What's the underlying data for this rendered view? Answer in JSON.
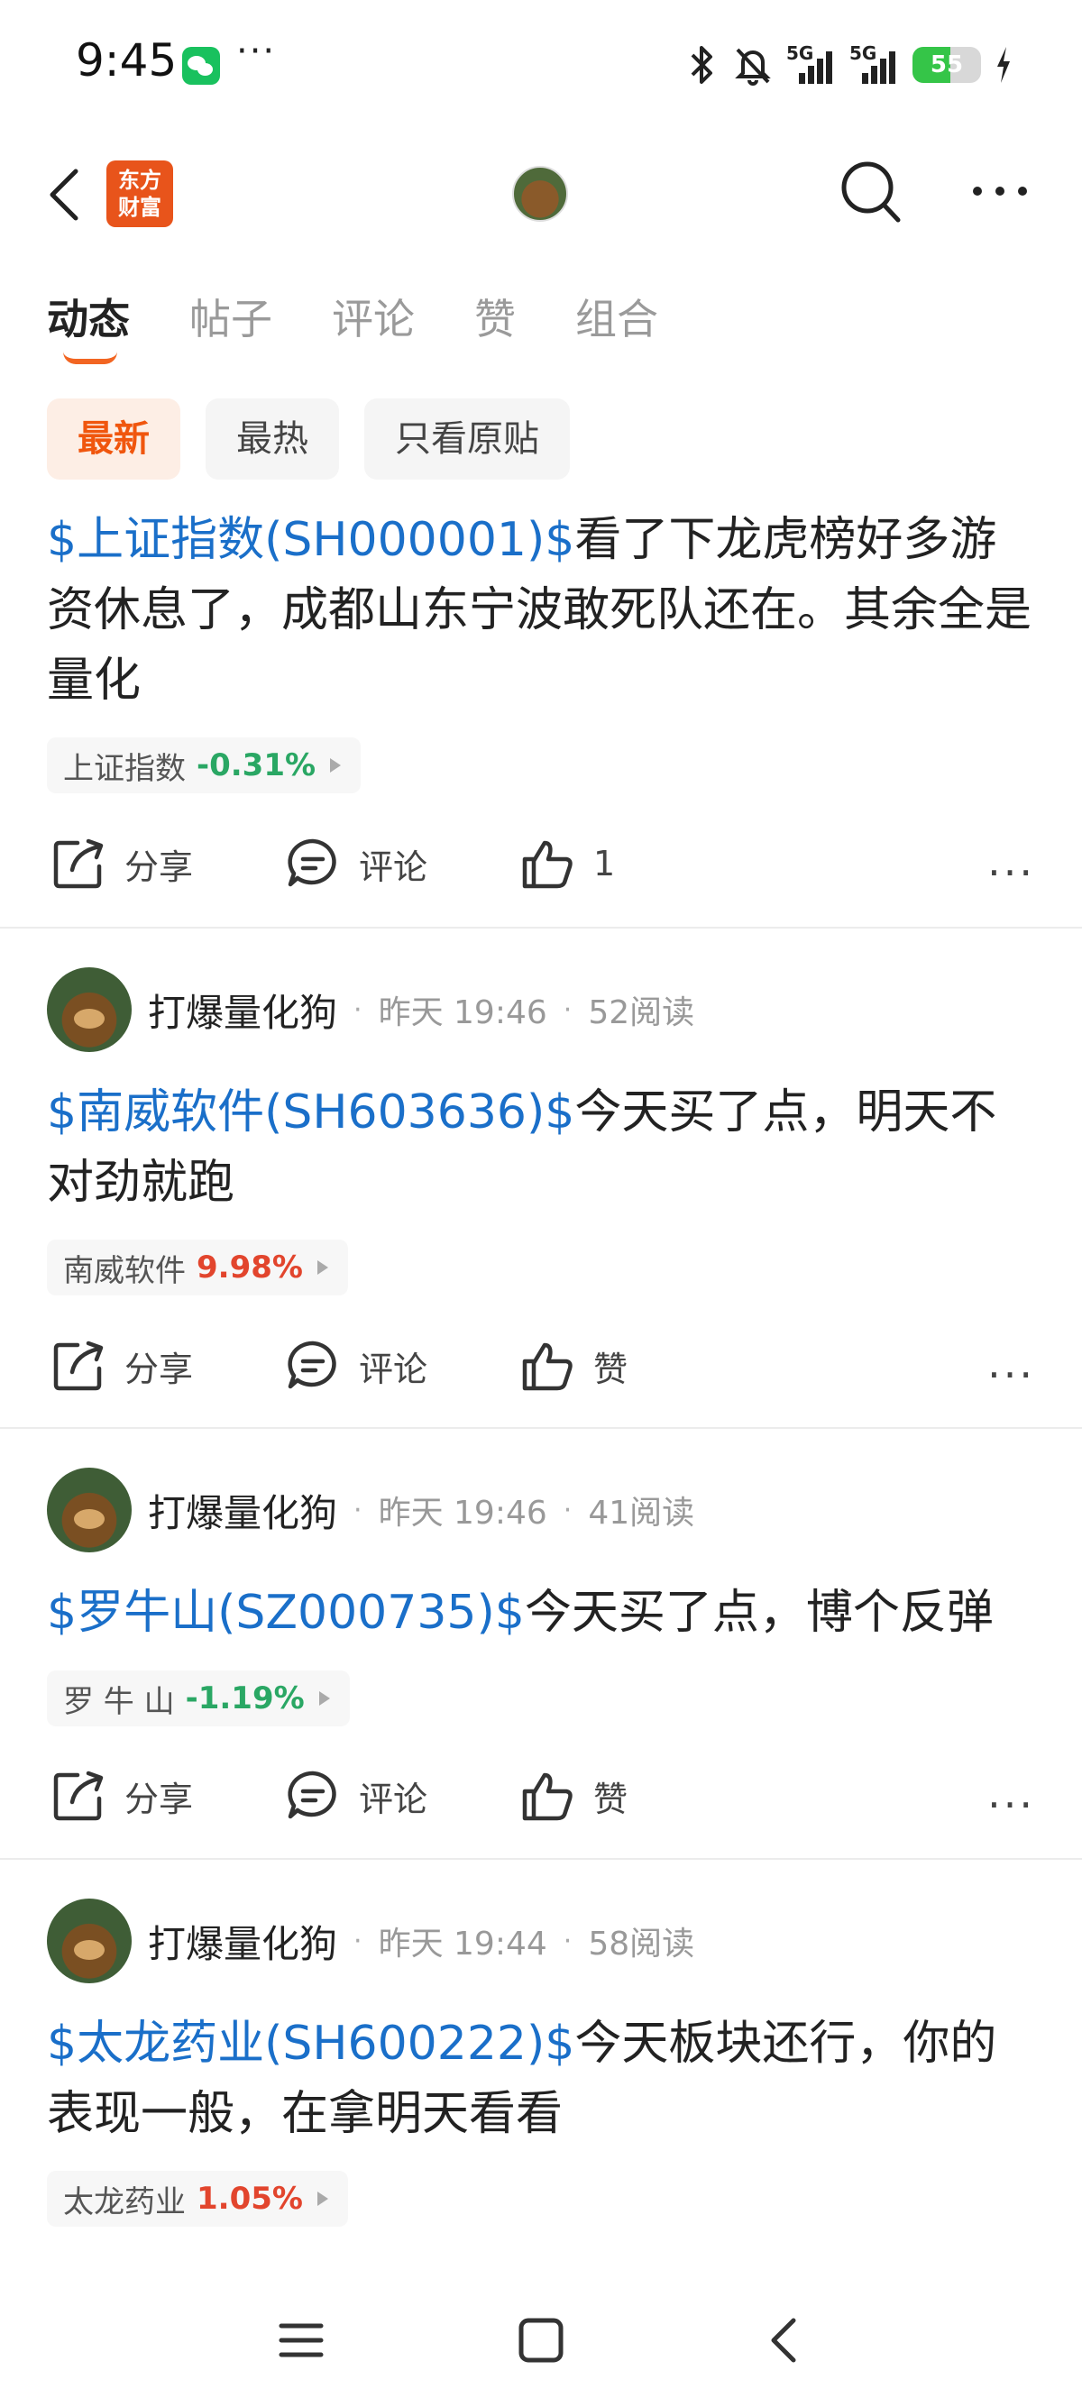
{
  "status_bar": {
    "time": "9:45",
    "wechat_icon": "wechat-icon",
    "more": "···",
    "signal_label_1": "5G",
    "signal_label_2": "5G",
    "battery": "55"
  },
  "header": {
    "logo_line1": "东方",
    "logo_line2": "财富"
  },
  "tabs": [
    {
      "label": "动态",
      "active": true
    },
    {
      "label": "帖子"
    },
    {
      "label": "评论"
    },
    {
      "label": "赞"
    },
    {
      "label": "组合"
    }
  ],
  "filters": [
    {
      "label": "最新",
      "active": true
    },
    {
      "label": "最热"
    },
    {
      "label": "只看原贴"
    }
  ],
  "actions": {
    "share": "分享",
    "comment": "评论",
    "like": "赞"
  },
  "posts": [
    {
      "stock_link": "$上证指数(SH000001)$",
      "text": "看了下龙虎榜好多游资休息了，成都山东宁波敢死队还在。其余全是量化",
      "tag_name": "上证指数",
      "tag_pct": "-0.31%",
      "like_count": "1"
    },
    {
      "user": "打爆量化狗",
      "time": "昨天 19:46",
      "reads": "52阅读",
      "stock_link": "$南威软件(SH603636)$",
      "text": "今天买了点，明天不对劲就跑",
      "tag_name": "南威软件",
      "tag_pct": "9.98%"
    },
    {
      "user": "打爆量化狗",
      "time": "昨天 19:46",
      "reads": "41阅读",
      "stock_link": "$罗牛山(SZ000735)$",
      "text": "今天买了点，博个反弹",
      "tag_name": "罗 牛 山",
      "tag_pct": "-1.19%"
    },
    {
      "user": "打爆量化狗",
      "time": "昨天 19:44",
      "reads": "58阅读",
      "stock_link": "$太龙药业(SH600222)$",
      "text": "今天板块还行，你的表现一般，在拿明天看看",
      "tag_name": "太龙药业",
      "tag_pct": "1.05%"
    }
  ],
  "colors": {
    "accent": "#f26522",
    "link": "#1a6fc9",
    "up": "#e2452d",
    "down": "#2aa764"
  }
}
